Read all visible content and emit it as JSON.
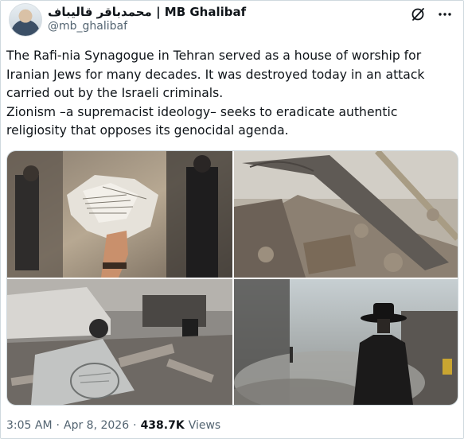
{
  "author": {
    "display_name": "محمدباقر قالیباف | MB Ghalibaf",
    "handle": "@mb_ghalibaf"
  },
  "icons": {
    "grok": "grok-slash-icon",
    "more": "more-dots-icon",
    "avatar": "profile-photo"
  },
  "tweet": {
    "paragraphs": [
      "The Rafi-nia Synagogue in Tehran served as a house of worship for Iranian Jews for many decades. It was destroyed today in an attack carried out by the Israeli criminals.",
      "Zionism –a supremacist ideology– seeks to eradicate authentic religiosity that opposes its genocidal agenda."
    ]
  },
  "media": {
    "photos": [
      {
        "subject": "hand holding torn Hebrew prayer book pages among rubble"
      },
      {
        "subject": "collapsed building debris with exposed beams"
      },
      {
        "subject": "damaged car and debris with a fallen sign"
      },
      {
        "subject": "man in black hat amid smoke and ruins"
      }
    ]
  },
  "meta": {
    "time": "3:05 AM",
    "sep1": "·",
    "date": "Apr 8, 2026",
    "sep2": "·",
    "views_count": "438.7K",
    "views_label": "Views"
  }
}
